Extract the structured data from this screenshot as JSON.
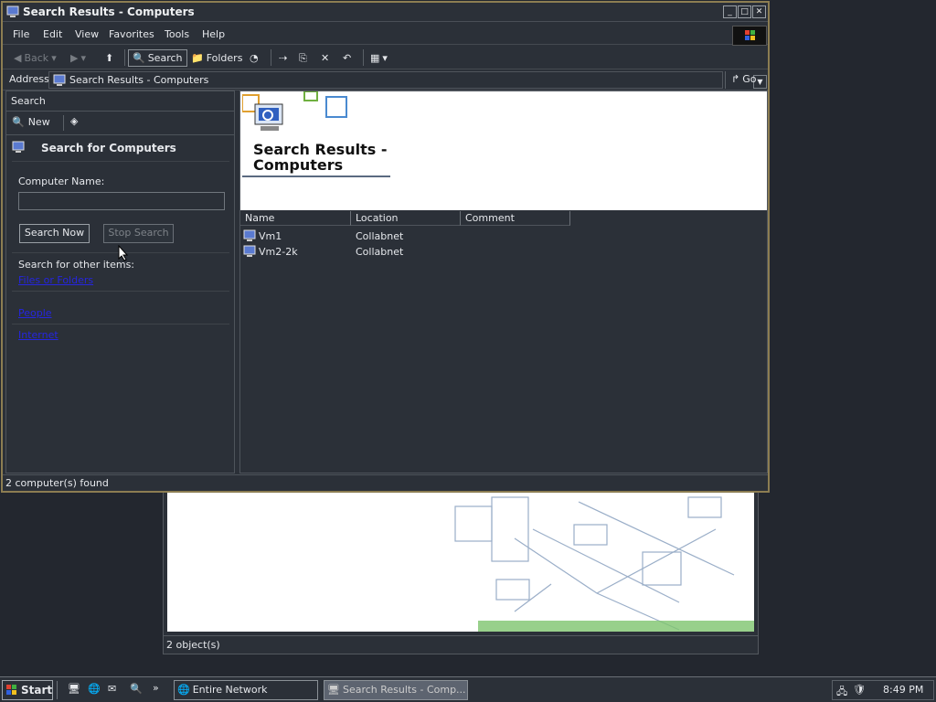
{
  "window": {
    "title": "Search Results - Computers",
    "min_label": "_",
    "max_label": "□",
    "close_label": "✕"
  },
  "menu": [
    "File",
    "Edit",
    "View",
    "Favorites",
    "Tools",
    "Help"
  ],
  "toolbar": {
    "back": "Back",
    "search": "Search",
    "folders": "Folders"
  },
  "address": {
    "label": "Address",
    "value": "Search Results - Computers",
    "go": "Go"
  },
  "search_pane": {
    "header": "Search",
    "new_label": "New",
    "heading": "Search for Computers",
    "computer_name_label": "Computer Name:",
    "computer_name_value": "",
    "search_now": "Search Now",
    "stop_search": "Stop Search",
    "other_items_label": "Search for other items:",
    "links": [
      "Files or Folders",
      "People",
      "Internet"
    ]
  },
  "results": {
    "banner_title_line1": "Search Results -",
    "banner_title_line2": "Computers",
    "columns": [
      "Name",
      "Location",
      "Comment"
    ],
    "rows": [
      {
        "name": "Vm1",
        "location": "Collabnet",
        "comment": ""
      },
      {
        "name": "Vm2-2k",
        "location": "Collabnet",
        "comment": ""
      }
    ]
  },
  "status": "2 computer(s) found",
  "background_window": {
    "status": "2 object(s)"
  },
  "taskbar": {
    "start": "Start",
    "tasks": [
      "Entire Network",
      "Search Results - Comp..."
    ],
    "clock": "8:49 PM"
  },
  "colors": {
    "chrome": "#2b3038",
    "border_accent": "#8c7d52",
    "link": "#2525e0"
  }
}
